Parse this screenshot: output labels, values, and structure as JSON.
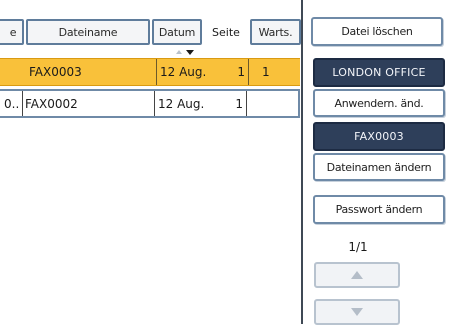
{
  "header": {
    "prev_col": "e",
    "filename_col": "Dateiname",
    "date_col": "Datum",
    "page_col": "Seite",
    "waiting_col": "Warts."
  },
  "rows": [
    {
      "prefix": "",
      "filename": "FAX0003",
      "date": "12 Aug.",
      "pages": "1",
      "waiting": "1"
    },
    {
      "prefix": "0..",
      "filename": "FAX0002",
      "date": "12 Aug.",
      "pages": "1",
      "waiting": ""
    }
  ],
  "side": {
    "delete_file": "Datei löschen",
    "user_name": "LONDON OFFICE",
    "change_user": "Anwendern. änd.",
    "file_name": "FAX0003",
    "change_file_name": "Dateinamen ändern",
    "change_password": "Passwort ändern",
    "page_indicator": "1/1"
  },
  "icons": {
    "sort": "sort-descending-icon",
    "up": "arrow-up-icon",
    "down": "arrow-down-icon"
  },
  "colors": {
    "selected_row": "#f9c13a",
    "accent_border": "#5f7c9b",
    "dark_button": "#2e3f5a"
  }
}
